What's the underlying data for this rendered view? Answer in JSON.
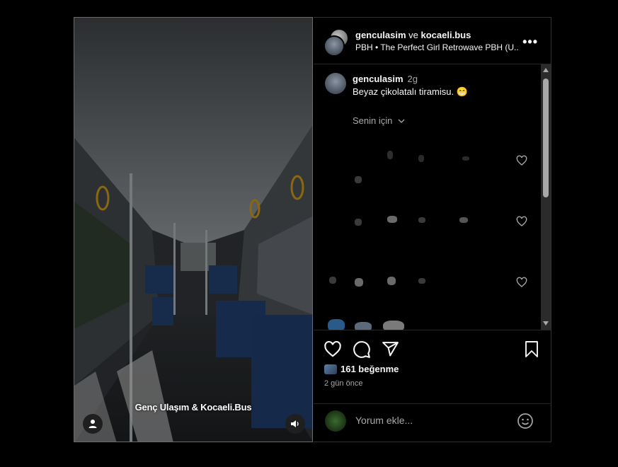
{
  "media": {
    "overlay_caption": "Genç Ulaşım & Kocaeli.Bus",
    "user_icon": "user-tag-icon",
    "sound_icon": "speaker-icon"
  },
  "header": {
    "user1": "genculasim",
    "joiner": "ve",
    "user2": "kocaeli.bus",
    "audio": "PBH • The Perfect Girl Retrowave PBH (U...",
    "more_icon": "more-options-icon",
    "more_glyph": "•••"
  },
  "post_caption": {
    "username": "genculasim",
    "time": "2g",
    "text": "Beyaz çikolatalı tiramisu. 😁",
    "filter_label": "Senin için"
  },
  "actions": {
    "like_icon": "heart-icon",
    "comment_icon": "comment-icon",
    "share_icon": "share-icon",
    "save_icon": "bookmark-icon"
  },
  "likes": {
    "text": "161 beğenme"
  },
  "date": "2 gün önce",
  "add_comment": {
    "placeholder": "Yorum ekle...",
    "emoji_icon": "emoji-icon"
  },
  "colors": {
    "background": "#000000",
    "text_primary": "#f5f5f5",
    "text_secondary": "#a8a8a8",
    "divider": "#262626"
  }
}
